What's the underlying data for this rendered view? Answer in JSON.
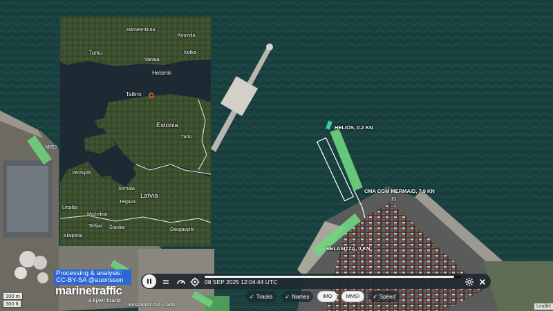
{
  "inset_map": {
    "places": [
      {
        "name": "Hämeenlinna",
        "size": "small"
      },
      {
        "name": "Kouvola",
        "size": "small"
      },
      {
        "name": "Turku",
        "size": "normal"
      },
      {
        "name": "Vantaa",
        "size": "small"
      },
      {
        "name": "Kotka",
        "size": "small"
      },
      {
        "name": "Helsinki",
        "size": "normal"
      },
      {
        "name": "Tallinn",
        "size": "normal"
      },
      {
        "name": "Estonia",
        "size": "big"
      },
      {
        "name": "Tartu",
        "size": "small"
      },
      {
        "name": "Ventspils",
        "size": "small"
      },
      {
        "name": "Jūrmala",
        "size": "small"
      },
      {
        "name": "Latvia",
        "size": "big"
      },
      {
        "name": "Jelgava",
        "size": "small"
      },
      {
        "name": "Liepāja",
        "size": "small"
      },
      {
        "name": "Mažeikiai",
        "size": "small"
      },
      {
        "name": "Telšiai",
        "size": "small"
      },
      {
        "name": "Šiauliai",
        "size": "small"
      },
      {
        "name": "Daugavpils",
        "size": "small"
      },
      {
        "name": "Klaipėda",
        "size": "small"
      }
    ]
  },
  "vessels": {
    "helios": "HELIOS, 0.2 KN",
    "cma": "CMA CGM MERMAID, 7.9 KN",
    "belasitza": "BELASITZA, 0 KN",
    "berth_number": "21"
  },
  "dock_labels": {
    "misj": "MISJ",
    "company": "Erisulamid OÜ - Ladu"
  },
  "credit": {
    "line1": "Processing & analysis:",
    "line2": "CC-BY-SA @auonsson"
  },
  "brand": {
    "name": "marinetraffic",
    "sub": "a kpler brand"
  },
  "scale": {
    "metric": "100 m",
    "imperial": "300 ft"
  },
  "playback": {
    "timestamp": "08 SEP 2025 12:04:44 UTC",
    "progress": 0.97
  },
  "layers": {
    "tracks": "Tracks",
    "names": "Names",
    "imo": "IMO",
    "mmsi": "MMSI",
    "speed": "Speed"
  },
  "attribution": "Leaflet",
  "colors": {
    "vessel_cargo": "#6fd67f",
    "vessel_tanker": "#3fc9a6",
    "credit_bg": "#2b67d8",
    "tallinn_marker": "#ff6a2a"
  }
}
